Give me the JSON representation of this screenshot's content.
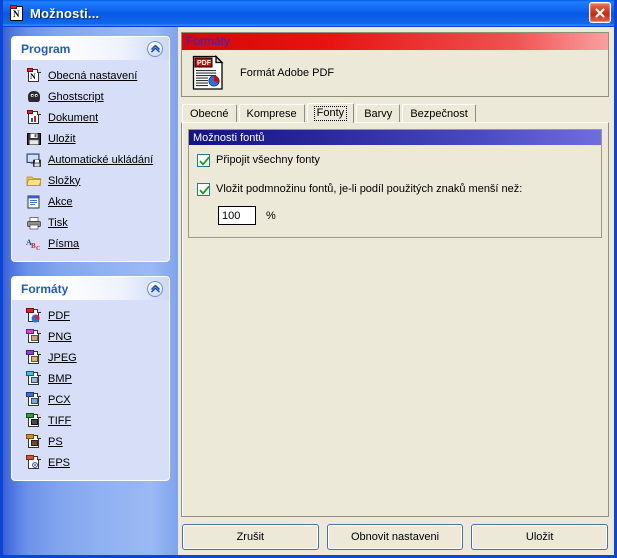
{
  "window": {
    "title": "Možnosti...",
    "title_icon": "document-n-icon",
    "close_label": "×"
  },
  "sidebar": {
    "panels": [
      {
        "title": "Program",
        "collapse_icon": "chevron-up-icon",
        "items": [
          {
            "label": "Obecná nastavení",
            "icon": "document-n-icon"
          },
          {
            "label": "Ghostscript",
            "icon": "ghost-icon"
          },
          {
            "label": "Dokument",
            "icon": "document-chart-icon"
          },
          {
            "label": "Uložit",
            "icon": "floppy-disk-icon"
          },
          {
            "label": "Automatické ukládání",
            "icon": "monitor-save-icon"
          },
          {
            "label": "Složky",
            "icon": "folder-icon"
          },
          {
            "label": "Akce",
            "icon": "clipboard-icon"
          },
          {
            "label": "Tisk",
            "icon": "printer-icon"
          },
          {
            "label": "Písma",
            "icon": "abc-font-icon"
          }
        ]
      },
      {
        "title": "Formáty",
        "collapse_icon": "chevron-up-icon",
        "items": [
          {
            "label": "PDF",
            "icon": "file-pdf-icon",
            "color": "#e02020"
          },
          {
            "label": "PNG",
            "icon": "file-png-icon",
            "color": "#d33fd3"
          },
          {
            "label": "JPEG",
            "icon": "file-jpeg-icon",
            "color": "#8f3fd3"
          },
          {
            "label": "BMP",
            "icon": "file-bmp-icon",
            "color": "#3fc2d3"
          },
          {
            "label": "PCX",
            "icon": "file-pcx-icon",
            "color": "#3f6fd3"
          },
          {
            "label": "TIFF",
            "icon": "file-tiff-icon",
            "color": "#2fa02f"
          },
          {
            "label": "PS",
            "icon": "file-ps-icon",
            "color": "#e08a20"
          },
          {
            "label": "EPS",
            "icon": "file-eps-icon",
            "color": "#d34f2f"
          }
        ]
      }
    ]
  },
  "main": {
    "header": {
      "title": "Formáty",
      "format_name": "Formát Adobe PDF",
      "format_icon": "pdf-document-icon"
    },
    "tabs": [
      {
        "label": "Obecné",
        "active": false
      },
      {
        "label": "Komprese",
        "active": false
      },
      {
        "label": "Fonty",
        "active": true
      },
      {
        "label": "Barvy",
        "active": false
      },
      {
        "label": "Bezpečnost",
        "active": false
      }
    ],
    "groupbox": {
      "title": "Možnosti fontů",
      "checkbox_embed_all": {
        "label": "Připojit všechny fonty",
        "checked": true
      },
      "checkbox_subset": {
        "label": "Vložit podmnožinu fontů, je-li podíl použitých znaků menší než:",
        "checked": true
      },
      "percent_value": "100",
      "percent_unit": "%"
    }
  },
  "buttons": {
    "cancel": "Zrušit",
    "restore": "Obnovit nastaveni",
    "save": "Uložit"
  },
  "colors": {
    "titlebar_blue": "#0e62f0",
    "sidebar_blue": "#8fb0f1",
    "panel_body": "#d6dff7",
    "content_bg": "#ece9d8",
    "header_red": "#e81414",
    "groupbox_navy": "#131384",
    "link_text": "#000000",
    "panel_title_blue": "#215ac4"
  }
}
